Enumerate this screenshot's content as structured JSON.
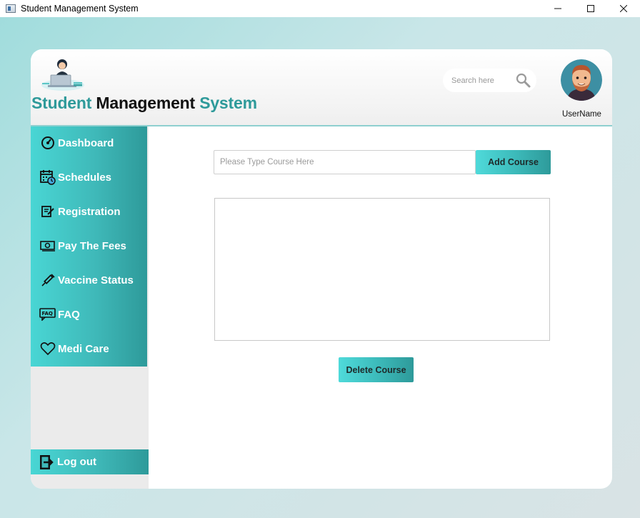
{
  "window": {
    "title": "Student Management System",
    "controls": {
      "minimize": "—",
      "maximize": "☐",
      "close": "✕"
    }
  },
  "header": {
    "brand": {
      "word1": "Student",
      "word2": "Management",
      "word3": "System"
    },
    "search_placeholder": "Search here",
    "username": "UserName"
  },
  "sidebar": {
    "items": [
      {
        "label": "Dashboard",
        "icon": "speedometer-icon"
      },
      {
        "label": "Schedules",
        "icon": "calendar-clock-icon"
      },
      {
        "label": "Registration",
        "icon": "edit-form-icon"
      },
      {
        "label": "Pay The Fees",
        "icon": "money-icon"
      },
      {
        "label": "Vaccine Status",
        "icon": "syringe-icon"
      },
      {
        "label": "FAQ",
        "icon": "faq-icon"
      },
      {
        "label": "Medi Care",
        "icon": "heart-icon"
      }
    ],
    "logout": {
      "label": "Log out",
      "icon": "logout-icon"
    }
  },
  "main": {
    "course_input_placeholder": "Please Type Course Here",
    "add_button": "Add Course",
    "delete_button": "Delete Course",
    "courses": []
  },
  "colors": {
    "accent": "#2e9a9a",
    "accent_light": "#49d6d4",
    "background": "#c9e6e8"
  }
}
